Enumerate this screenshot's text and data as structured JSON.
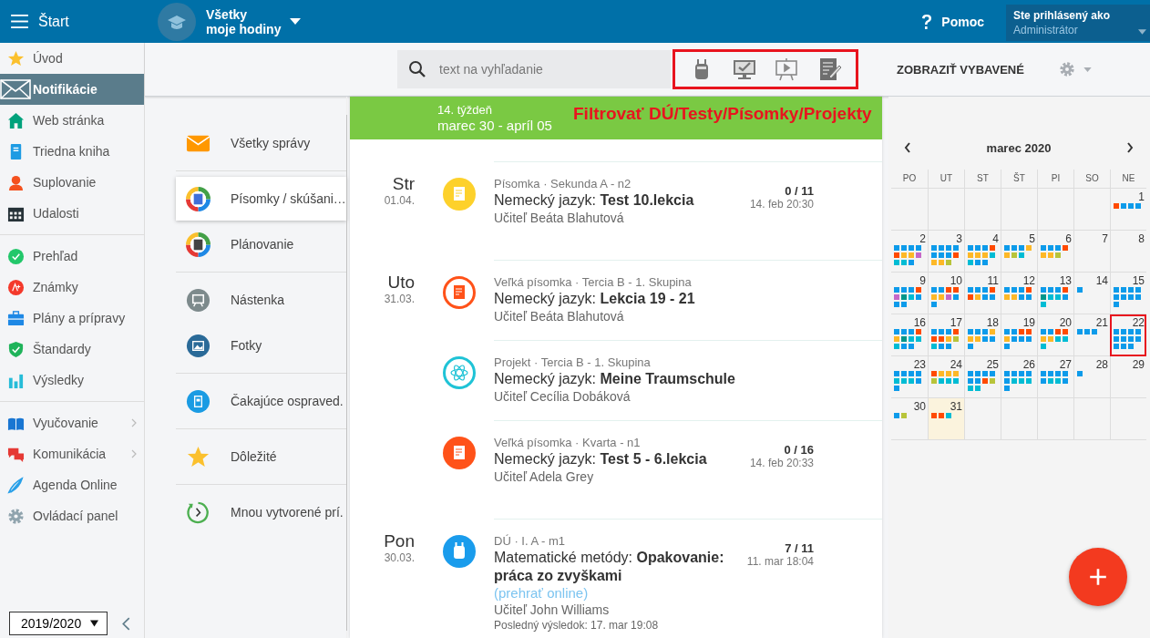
{
  "topbar": {
    "menu_label": "Štart",
    "course_lines": [
      "Všetky",
      "moje hodiny"
    ],
    "help": "Pomoc",
    "user_caption": "Ste prihlásený ako",
    "user_name": "Administrátor"
  },
  "sidebar": {
    "groups": [
      [
        {
          "label": "Úvod",
          "kind": "star",
          "selected": false,
          "submenu": false
        },
        {
          "label": "Notifikácie",
          "kind": "mail",
          "selected": true,
          "submenu": false
        },
        {
          "label": "Web stránka",
          "kind": "house",
          "selected": false,
          "submenu": false
        },
        {
          "label": "Triedna kniha",
          "kind": "notebook",
          "selected": false,
          "submenu": false
        },
        {
          "label": "Suplovanie",
          "kind": "person",
          "selected": false,
          "submenu": false
        },
        {
          "label": "Udalosti",
          "kind": "calendar",
          "selected": false,
          "submenu": false
        }
      ],
      [
        {
          "label": "Prehľad",
          "kind": "check",
          "selected": false,
          "submenu": false
        },
        {
          "label": "Známky",
          "kind": "grade",
          "selected": false,
          "submenu": false
        },
        {
          "label": "Plány a prípravy",
          "kind": "briefcase",
          "selected": false,
          "submenu": false
        },
        {
          "label": "Štandardy",
          "kind": "shield",
          "selected": false,
          "submenu": false
        },
        {
          "label": "Výsledky",
          "kind": "bars",
          "selected": false,
          "submenu": false
        }
      ],
      [
        {
          "label": "Vyučovanie",
          "kind": "book",
          "selected": false,
          "submenu": true
        },
        {
          "label": "Komunikácia",
          "kind": "chat",
          "selected": false,
          "submenu": true
        },
        {
          "label": "Agenda Online",
          "kind": "pen",
          "selected": false,
          "submenu": false
        },
        {
          "label": "Ovládací panel",
          "kind": "gear",
          "selected": false,
          "submenu": false
        }
      ]
    ],
    "year": "2019/2020"
  },
  "toolbar": {
    "search_placeholder": "text na vyhľadanie",
    "filters": [
      {
        "kind": "backpack"
      },
      {
        "kind": "monitor"
      },
      {
        "kind": "board"
      },
      {
        "kind": "document"
      }
    ],
    "show_done": "ZOBRAZIŤ VYBAVENÉ"
  },
  "categories": [
    [
      {
        "label": "Všetky správy",
        "kind": "mail",
        "selected": false
      }
    ],
    [
      {
        "label": "Písomky / skúšani…",
        "kind": "ring-doc",
        "selected": true
      },
      {
        "label": "Plánovanie",
        "kind": "ring-cal",
        "selected": false
      }
    ],
    [
      {
        "label": "Nástenka",
        "kind": "board",
        "selected": false
      },
      {
        "label": "Fotky",
        "kind": "photo",
        "selected": false
      }
    ],
    [
      {
        "label": "Čakajúce ospraved.",
        "kind": "clipboard",
        "selected": false
      }
    ],
    [
      {
        "label": "Dôležité",
        "kind": "star",
        "selected": false
      }
    ],
    [
      {
        "label": "Mnou vytvorené prí.",
        "kind": "clock",
        "selected": false
      }
    ]
  ],
  "feed": {
    "week": "14. týždeň",
    "range": "marec 30 - apríl 05",
    "annotation": "Filtrovať DÚ/Testy/Písomky/Projekty",
    "days": [
      {
        "day": "Str",
        "date": "01.04.",
        "items": [
          {
            "kind": "test",
            "outlined": false,
            "meta": "Písomka · Sekunda A - n2",
            "title": "Nemecký jazyk: **Test 10.lekcia**",
            "teacher": "Učiteľ Beáta Blahutová",
            "count": "0 / 11",
            "time": "14. feb 20:30"
          }
        ]
      },
      {
        "day": "Uto",
        "date": "31.03.",
        "items": [
          {
            "kind": "big_test",
            "outlined": true,
            "meta": "Veľká písomka · Tercia B - 1. Skupina",
            "title": "Nemecký jazyk: **Lekcia 19 - 21**",
            "teacher": "Učiteľ Beáta Blahutová"
          },
          {
            "kind": "project",
            "outlined": true,
            "meta": "Projekt · Tercia B - 1. Skupina",
            "title": "Nemecký jazyk: **Meine Traumschule**",
            "teacher": "Učiteľ Cecília Dobáková"
          },
          {
            "kind": "big_test",
            "outlined": false,
            "meta": "Veľká písomka · Kvarta - n1",
            "title": "Nemecký jazyk: **Test 5 - 6.lekcia**",
            "teacher": "Učiteľ Adela Grey",
            "count": "0 / 16",
            "time": "14. feb 20:33"
          }
        ]
      },
      {
        "day": "Pon",
        "date": "30.03.",
        "items": [
          {
            "kind": "homework",
            "outlined": false,
            "meta": "DÚ · I. A - m1",
            "title": "Matematické metódy: **Opakovanie: práca zo zvyškami**",
            "link": "(prehrať online)",
            "teacher": "Učiteľ John Williams",
            "last_result": "Posledný výsledok: 17. mar 19:08",
            "count": "7 / 11",
            "time": "11. mar 18:04"
          }
        ]
      }
    ]
  },
  "calendar": {
    "month": "marec 2020",
    "weekdays": [
      "PO",
      "UT",
      "ST",
      "ŠT",
      "PI",
      "SO",
      "NE"
    ],
    "weeks": [
      [
        {
          "day": "1",
          "today": false,
          "highlighted": false,
          "dots": [
            {
              "color": "#ff4a00"
            },
            {
              "color": "#0d9bea"
            },
            {
              "color": "#0d9bea"
            },
            {
              "color": "#0d9bea"
            }
          ]
        }
      ],
      [
        {
          "day": "2",
          "today": false,
          "highlighted": false,
          "dots": [
            {
              "color": "#0d9bea"
            },
            {
              "color": "#0d9bea"
            },
            {
              "color": "#0d9bea"
            },
            {
              "color": "#0d9bea"
            },
            {
              "color": "#ff4a00"
            },
            {
              "color": "#fdb827"
            },
            {
              "color": "#fdb827"
            },
            {
              "color": "#c668c8"
            },
            {
              "color": "#00bcd4"
            },
            {
              "color": "#00bcd4"
            },
            {
              "color": "#0d9bea"
            }
          ]
        },
        {
          "day": "3",
          "today": false,
          "highlighted": false,
          "dots": [
            {
              "color": "#0d9bea"
            },
            {
              "color": "#0d9bea"
            },
            {
              "color": "#0d9bea"
            },
            {
              "color": "#0d9bea"
            },
            {
              "color": "#0d9bea"
            },
            {
              "color": "#0d9bea"
            },
            {
              "color": "#0d9bea"
            },
            {
              "color": "#ff4a00"
            },
            {
              "color": "#fdb827"
            },
            {
              "color": "#fdb827"
            },
            {
              "color": "#b8c43a"
            }
          ]
        },
        {
          "day": "4",
          "today": false,
          "highlighted": false,
          "dots": [
            {
              "color": "#0d9bea"
            },
            {
              "color": "#0d9bea"
            },
            {
              "color": "#0d9bea"
            },
            {
              "color": "#ff4a00"
            },
            {
              "color": "#fdb827"
            },
            {
              "color": "#fdb827"
            },
            {
              "color": "#fdb827"
            },
            {
              "color": "#00bcd4"
            },
            {
              "color": "#00bcd4"
            },
            {
              "color": "#0d9bea"
            },
            {
              "color": "#0d9bea"
            }
          ]
        },
        {
          "day": "5",
          "today": false,
          "highlighted": false,
          "dots": [
            {
              "color": "#0d9bea"
            },
            {
              "color": "#0d9bea"
            },
            {
              "color": "#0d9bea"
            },
            {
              "color": "#fdb827"
            },
            {
              "color": "#fdb827"
            },
            {
              "color": "#b8c43a"
            },
            {
              "color": "#00bcd4"
            }
          ]
        },
        {
          "day": "6",
          "today": false,
          "highlighted": false,
          "dots": [
            {
              "color": "#0d9bea"
            },
            {
              "color": "#0d9bea"
            },
            {
              "color": "#0d9bea"
            },
            {
              "color": "#ff4a00"
            },
            {
              "color": "#fdb827"
            },
            {
              "color": "#fdb827"
            },
            {
              "color": "#b8c43a"
            }
          ]
        },
        {
          "day": "7",
          "today": false,
          "highlighted": false
        },
        {
          "day": "8",
          "today": false,
          "highlighted": false
        }
      ],
      [
        {
          "day": "9",
          "today": false,
          "highlighted": false,
          "dots": [
            {
              "color": "#0d9bea"
            },
            {
              "color": "#0d9bea"
            },
            {
              "color": "#0d9bea"
            },
            {
              "color": "#ff4a00"
            },
            {
              "color": "#c668c8"
            },
            {
              "color": "#00968a"
            },
            {
              "color": "#00bcd4"
            },
            {
              "color": "#0d9bea"
            },
            {
              "color": "#0d9bea"
            },
            {
              "color": "#0d9bea"
            }
          ]
        },
        {
          "day": "10",
          "today": false,
          "highlighted": false,
          "dots": [
            {
              "color": "#0d9bea"
            },
            {
              "color": "#0d9bea"
            },
            {
              "color": "#ff4a00"
            },
            {
              "color": "#ff4a00"
            },
            {
              "color": "#fdb827"
            },
            {
              "color": "#fdb827"
            },
            {
              "color": "#c668c8"
            },
            {
              "color": "#0d9bea"
            },
            {
              "color": "#0d9bea"
            }
          ]
        },
        {
          "day": "11",
          "today": false,
          "highlighted": false,
          "dots": [
            {
              "color": "#0d9bea"
            },
            {
              "color": "#0d9bea"
            },
            {
              "color": "#0d9bea"
            },
            {
              "color": "#ff4a00"
            },
            {
              "color": "#ff4a00"
            },
            {
              "color": "#fdb827"
            },
            {
              "color": "#0d9bea"
            },
            {
              "color": "#0d9bea"
            }
          ]
        },
        {
          "day": "12",
          "today": false,
          "highlighted": false,
          "dots": [
            {
              "color": "#0d9bea"
            },
            {
              "color": "#0d9bea"
            },
            {
              "color": "#0d9bea"
            },
            {
              "color": "#ff4a00"
            },
            {
              "color": "#fdb827"
            },
            {
              "color": "#fdb827"
            },
            {
              "color": "#0d9bea"
            },
            {
              "color": "#0d9bea"
            }
          ]
        },
        {
          "day": "13",
          "today": false,
          "highlighted": false,
          "dots": [
            {
              "color": "#0d9bea"
            },
            {
              "color": "#0d9bea"
            },
            {
              "color": "#0d9bea"
            },
            {
              "color": "#ff4a00"
            },
            {
              "color": "#00968a"
            },
            {
              "color": "#00bcd4"
            },
            {
              "color": "#00bcd4"
            },
            {
              "color": "#0d9bea"
            },
            {
              "color": "#00bcd4"
            }
          ]
        },
        {
          "day": "14",
          "today": false,
          "highlighted": false,
          "dots": [
            {
              "color": "#0d9bea"
            }
          ]
        },
        {
          "day": "15",
          "today": false,
          "highlighted": false,
          "dots": [
            {
              "color": "#0d9bea"
            },
            {
              "color": "#0d9bea"
            },
            {
              "color": "#0d9bea"
            },
            {
              "color": "#0d9bea"
            },
            {
              "color": "#0d9bea"
            },
            {
              "color": "#0d9bea"
            },
            {
              "color": "#0d9bea"
            },
            {
              "color": "#0d9bea"
            },
            {
              "color": "#0d9bea"
            }
          ]
        }
      ],
      [
        {
          "day": "16",
          "today": false,
          "highlighted": false,
          "dots": [
            {
              "color": "#0d9bea"
            },
            {
              "color": "#0d9bea"
            },
            {
              "color": "#0d9bea"
            },
            {
              "color": "#ff4a00"
            },
            {
              "color": "#fdb827"
            },
            {
              "color": "#00968a"
            },
            {
              "color": "#00bcd4"
            },
            {
              "color": "#00bcd4"
            },
            {
              "color": "#00bcd4"
            },
            {
              "color": "#0d9bea"
            },
            {
              "color": "#0d9bea"
            }
          ]
        },
        {
          "day": "17",
          "today": false,
          "highlighted": false,
          "dots": [
            {
              "color": "#0d9bea"
            },
            {
              "color": "#0d9bea"
            },
            {
              "color": "#0d9bea"
            },
            {
              "color": "#ff4a00"
            },
            {
              "color": "#ff4a00"
            },
            {
              "color": "#ff4a00"
            },
            {
              "color": "#fdb827"
            },
            {
              "color": "#b8c43a"
            },
            {
              "color": "#00bcd4"
            },
            {
              "color": "#0d9bea"
            },
            {
              "color": "#0d9bea"
            }
          ]
        },
        {
          "day": "18",
          "today": false,
          "highlighted": false,
          "dots": [
            {
              "color": "#0d9bea"
            },
            {
              "color": "#0d9bea"
            },
            {
              "color": "#0d9bea"
            },
            {
              "color": "#fdb827"
            },
            {
              "color": "#fdb827"
            },
            {
              "color": "#fdb827"
            },
            {
              "color": "#0d9bea"
            },
            {
              "color": "#0d9bea"
            },
            {
              "color": "#0d9bea"
            }
          ]
        },
        {
          "day": "19",
          "today": false,
          "highlighted": false,
          "dots": [
            {
              "color": "#0d9bea"
            },
            {
              "color": "#0d9bea"
            },
            {
              "color": "#ff4a00"
            },
            {
              "color": "#ff4a00"
            },
            {
              "color": "#fdb827"
            },
            {
              "color": "#0d9bea"
            },
            {
              "color": "#0d9bea"
            },
            {
              "color": "#0d9bea"
            },
            {
              "color": "#0d9bea"
            }
          ]
        },
        {
          "day": "20",
          "today": false,
          "highlighted": false,
          "dots": [
            {
              "color": "#0d9bea"
            },
            {
              "color": "#0d9bea"
            },
            {
              "color": "#ff4a00"
            },
            {
              "color": "#ff4a00"
            },
            {
              "color": "#fdb827"
            },
            {
              "color": "#fdb827"
            },
            {
              "color": "#00bcd4"
            },
            {
              "color": "#00bcd4"
            },
            {
              "color": "#00bcd4"
            }
          ]
        },
        {
          "day": "21",
          "today": false,
          "highlighted": false,
          "dots": [
            {
              "color": "#0d9bea"
            },
            {
              "color": "#0d9bea"
            },
            {
              "color": "#0d9bea"
            }
          ]
        },
        {
          "day": "22",
          "today": false,
          "highlighted": true,
          "dots": [
            {
              "color": "#0d9bea"
            },
            {
              "color": "#0d9bea"
            },
            {
              "color": "#0d9bea"
            },
            {
              "color": "#0d9bea"
            },
            {
              "color": "#0d9bea"
            },
            {
              "color": "#0d9bea"
            },
            {
              "color": "#0d9bea"
            },
            {
              "color": "#0d9bea"
            },
            {
              "color": "#0d9bea"
            },
            {
              "color": "#0d9bea"
            },
            {
              "color": "#0d9bea"
            }
          ]
        }
      ],
      [
        {
          "day": "23",
          "today": false,
          "highlighted": false,
          "dots": [
            {
              "color": "#0d9bea"
            },
            {
              "color": "#0d9bea"
            },
            {
              "color": "#0d9bea"
            },
            {
              "color": "#0d9bea"
            },
            {
              "color": "#00bcd4"
            },
            {
              "color": "#00bcd4"
            },
            {
              "color": "#00bcd4"
            },
            {
              "color": "#0d9bea"
            },
            {
              "color": "#0d9bea"
            }
          ]
        },
        {
          "day": "24",
          "today": false,
          "highlighted": false,
          "dots": [
            {
              "color": "#ff4a00"
            },
            {
              "color": "#fdb827"
            },
            {
              "color": "#fdb827"
            },
            {
              "color": "#fdb827"
            },
            {
              "color": "#b8c43a"
            },
            {
              "color": "#00bcd4"
            },
            {
              "color": "#00bcd4"
            },
            {
              "color": "#00bcd4"
            }
          ]
        },
        {
          "day": "25",
          "today": false,
          "highlighted": false,
          "dots": [
            {
              "color": "#0d9bea"
            },
            {
              "color": "#0d9bea"
            },
            {
              "color": "#0d9bea"
            },
            {
              "color": "#0d9bea"
            },
            {
              "color": "#0d9bea"
            },
            {
              "color": "#0d9bea"
            },
            {
              "color": "#ff4a00"
            },
            {
              "color": "#b8c43a"
            },
            {
              "color": "#00bcd4"
            },
            {
              "color": "#00bcd4"
            }
          ]
        },
        {
          "day": "26",
          "today": false,
          "highlighted": false,
          "dots": [
            {
              "color": "#0d9bea"
            },
            {
              "color": "#0d9bea"
            },
            {
              "color": "#0d9bea"
            },
            {
              "color": "#0d9bea"
            },
            {
              "color": "#0d9bea"
            },
            {
              "color": "#00bcd4"
            },
            {
              "color": "#00bcd4"
            },
            {
              "color": "#00bcd4"
            },
            {
              "color": "#0d9bea"
            }
          ]
        },
        {
          "day": "27",
          "today": false,
          "highlighted": false,
          "dots": [
            {
              "color": "#0d9bea"
            },
            {
              "color": "#0d9bea"
            },
            {
              "color": "#0d9bea"
            },
            {
              "color": "#0d9bea"
            },
            {
              "color": "#0d9bea"
            },
            {
              "color": "#00bcd4"
            },
            {
              "color": "#00bcd4"
            },
            {
              "color": "#0d9bea"
            }
          ]
        },
        {
          "day": "28",
          "today": false,
          "highlighted": false,
          "dots": [
            {
              "color": "#0d9bea"
            }
          ]
        },
        {
          "day": "29",
          "today": false,
          "highlighted": false
        }
      ],
      [
        {
          "day": "30",
          "today": false,
          "highlighted": false,
          "dots": [
            {
              "color": "#0d9bea"
            },
            {
              "color": "#b8c43a"
            }
          ]
        },
        {
          "day": "31",
          "today": true,
          "highlighted": false,
          "dots": [
            {
              "color": "#ff4a00"
            },
            {
              "color": "#ff4a00"
            },
            {
              "color": "#00bcd4"
            }
          ]
        }
      ]
    ]
  }
}
